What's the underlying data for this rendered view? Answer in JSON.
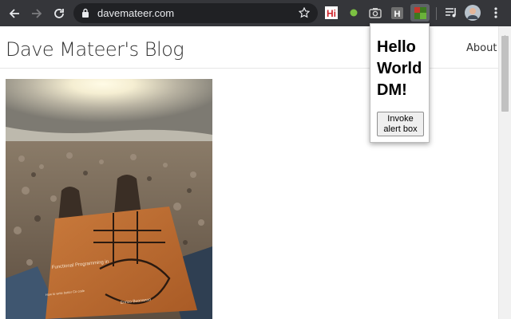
{
  "browser": {
    "url": "davemateer.com"
  },
  "site": {
    "title": "Dave Mateer's Blog",
    "nav": {
      "about": "About"
    }
  },
  "photo": {
    "book_title": "Functional Programming in",
    "book_subtitle": "How to write better C# code",
    "book_author": "Enrico Buonanno"
  },
  "popup": {
    "title_lines": [
      "Hello",
      "World",
      "DM!"
    ],
    "button_line1": "Invoke",
    "button_line2": "alert box"
  },
  "extensions": {
    "hi_label": "Hi",
    "h_label": "H"
  }
}
